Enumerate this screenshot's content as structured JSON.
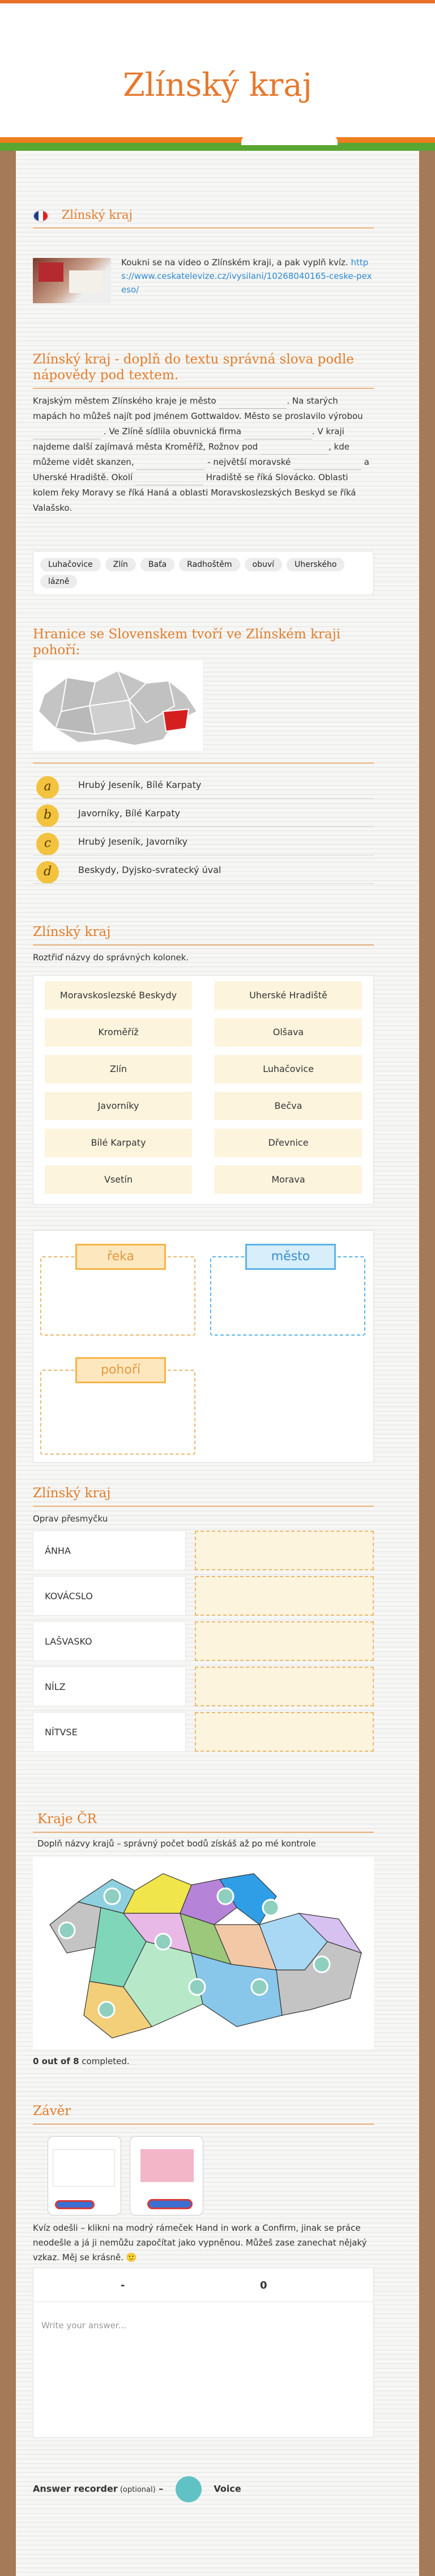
{
  "page": {
    "title": "Zlínský kraj"
  },
  "intro": {
    "title": "Zlínský kraj",
    "text": "Koukni se na video o Zlínském kraji, a pak vyplň kvíz. ",
    "link": "https://www.ceskatelevize.cz/ivysilani/10268040165-ceske-pexeso/"
  },
  "fill": {
    "title": "Zlínský kraj - doplň do textu správná slova podle nápovědy pod textem.",
    "t1": "Krajským městem Zlínského kraje je město",
    "t2": ". Na starých mapách ho můžeš najít pod jménem Gottwaldov. Město se proslavilo výrobou",
    "t3": ". Ve Zlíně sídlila obuvnická firma",
    "t4": ". V kraji najdeme další zajímavá města Kroměříž, Rožnov pod",
    "t5": ", kde můžeme vidět skanzen,",
    "t6": "- největší moravské",
    "t7": "a Uherské Hradiště. Okolí",
    "t8": "Hradiště se říká Slovácko. Oblasti kolem řeky Moravy se říká Haná a oblasti Moravskoslezských Beskyd se říká Valašsko.",
    "chips": [
      "Luhačovice",
      "Zlín",
      "Baťa",
      "Radhoštěm",
      "obuví",
      "Uherského",
      "lázně"
    ]
  },
  "quiz": {
    "title": "Hranice se Slovenskem tvoří ve Zlínském kraji pohoří:",
    "options": [
      {
        "letter": "a",
        "text": "Hrubý Jeseník, Bílé Karpaty"
      },
      {
        "letter": "b",
        "text": "Javorníky, Bílé Karpaty"
      },
      {
        "letter": "c",
        "text": "Hrubý Jeseník, Javorníky"
      },
      {
        "letter": "d",
        "text": "Beskydy, Dyjsko-svratecký úval"
      }
    ]
  },
  "sort": {
    "title": "Zlínský kraj",
    "instruction": "Roztřiď názvy do správných kolonek.",
    "items": [
      "Moravskoslezské Beskydy",
      "Uherské Hradiště",
      "Kroměříž",
      "Olšava",
      "Zlín",
      "Luhačovice",
      "Javorníky",
      "Bečva",
      "Bílé Karpaty",
      "Dřevnice",
      "Vsetín",
      "Morava"
    ],
    "buckets": [
      "řeka",
      "město",
      "pohoří"
    ]
  },
  "anagram": {
    "title": "Zlínský kraj",
    "instruction": "Oprav přesmyčku",
    "words": [
      "ÁNHA",
      "KOVÁCSLO",
      "LAŠVASKO",
      "NÍLZ",
      "NÍTVSE"
    ]
  },
  "map": {
    "title": "Kraje ČR",
    "instruction": "Doplň názvy krajů – správný počet bodů získáš až po mé kontrole",
    "progress": "0 out of 8",
    "progress_suffix": " completed.",
    "colors": [
      "#c4c4c4",
      "#8ed0e0",
      "#f0e54a",
      "#b584d8",
      "#2f9ee6",
      "#7fd6b8",
      "#e8b8e6",
      "#9bc87a",
      "#f3c8a6",
      "#a9d8f5",
      "#d6c1f0",
      "#f4cf7a",
      "#b7e9c8",
      "#88c6ea"
    ]
  },
  "end": {
    "title": "Závěr",
    "text": "Kvíz odešli – klikni na modrý rámeček Hand in work a Confirm, jinak se práce neodešle a já ji nemůžu započítat jako vypněnou. Můžeš zase zanechat nějaký vzkaz. Měj se krásně.",
    "emoji": "🙂",
    "header_left": "-",
    "header_right": "0",
    "placeholder": "Write your answer...",
    "recorder_label": "Answer recorder",
    "recorder_optional": " (optional)",
    "recorder_dash": " –",
    "voice": "Voice"
  }
}
